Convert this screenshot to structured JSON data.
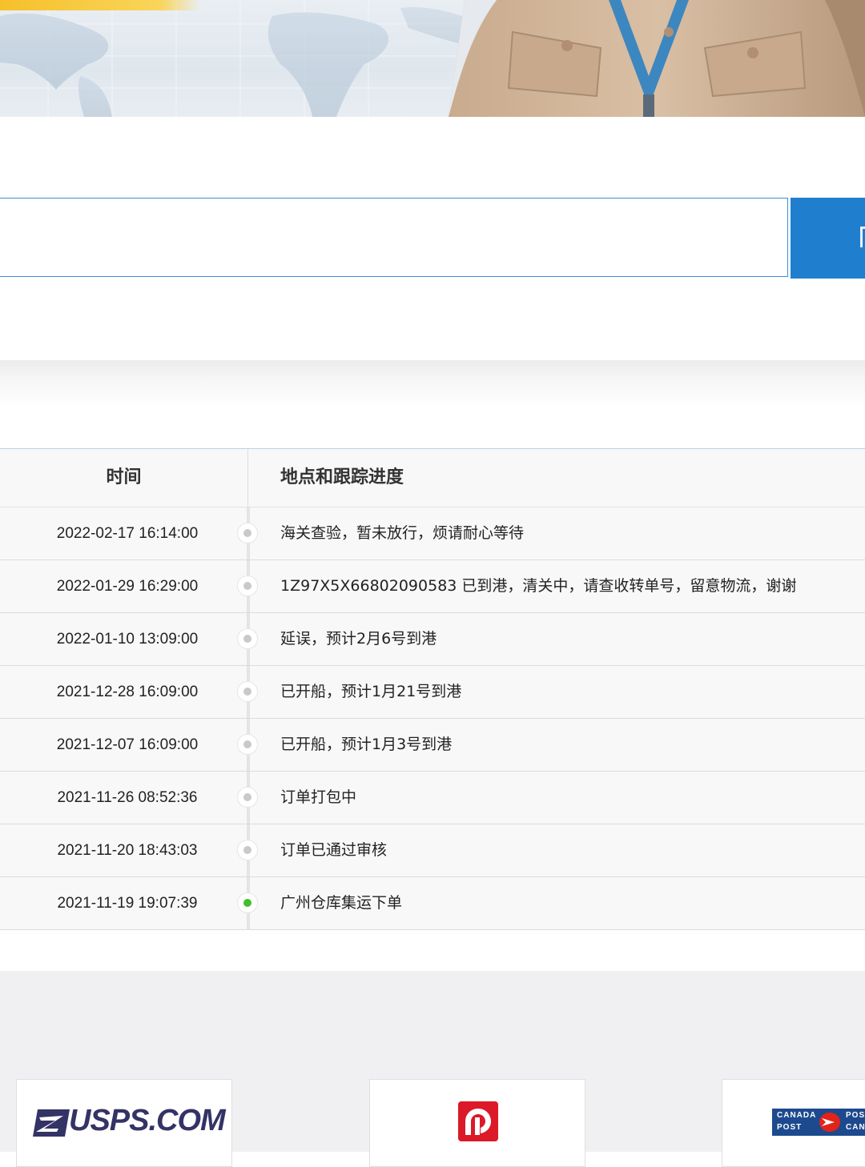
{
  "hero": {
    "banner_icon": "world-map-courier-banner"
  },
  "search": {
    "placeholder": "",
    "button_icon": "search-icon"
  },
  "table": {
    "headers": {
      "time": "时间",
      "location": "地点和跟踪进度"
    },
    "rows": [
      {
        "time": "2022-02-17 16:14:00",
        "desc": "海关查验，暂未放行，烦请耐心等待",
        "status": "past"
      },
      {
        "time": "2022-01-29 16:29:00",
        "desc": "1Z97X5X66802090583 已到港，清关中，请查收转单号，留意物流，谢谢",
        "status": "past"
      },
      {
        "time": "2022-01-10 13:09:00",
        "desc": "延误，预计2月6号到港",
        "status": "past"
      },
      {
        "time": "2021-12-28 16:09:00",
        "desc": "已开船，预计1月21号到港",
        "status": "past"
      },
      {
        "time": "2021-12-07 16:09:00",
        "desc": "已开船，预计1月3号到港",
        "status": "past"
      },
      {
        "time": "2021-11-26 08:52:36",
        "desc": "订单打包中",
        "status": "past"
      },
      {
        "time": "2021-11-20 18:43:03",
        "desc": "订单已通过审核",
        "status": "past"
      },
      {
        "time": "2021-11-19 19:07:39",
        "desc": "广州仓库集运下单",
        "status": "origin"
      }
    ],
    "colors": {
      "past_dot": "#c9c9c9",
      "origin_dot": "#3fbf2a",
      "header_border": "#b6d3ec"
    }
  },
  "partners": {
    "usps": "USPS.COM",
    "canada_line1": "CANADA",
    "canada_line2": "POST",
    "canada_line3": "POS",
    "canada_line4": "CAN"
  },
  "accent_color": "#1f7fce"
}
